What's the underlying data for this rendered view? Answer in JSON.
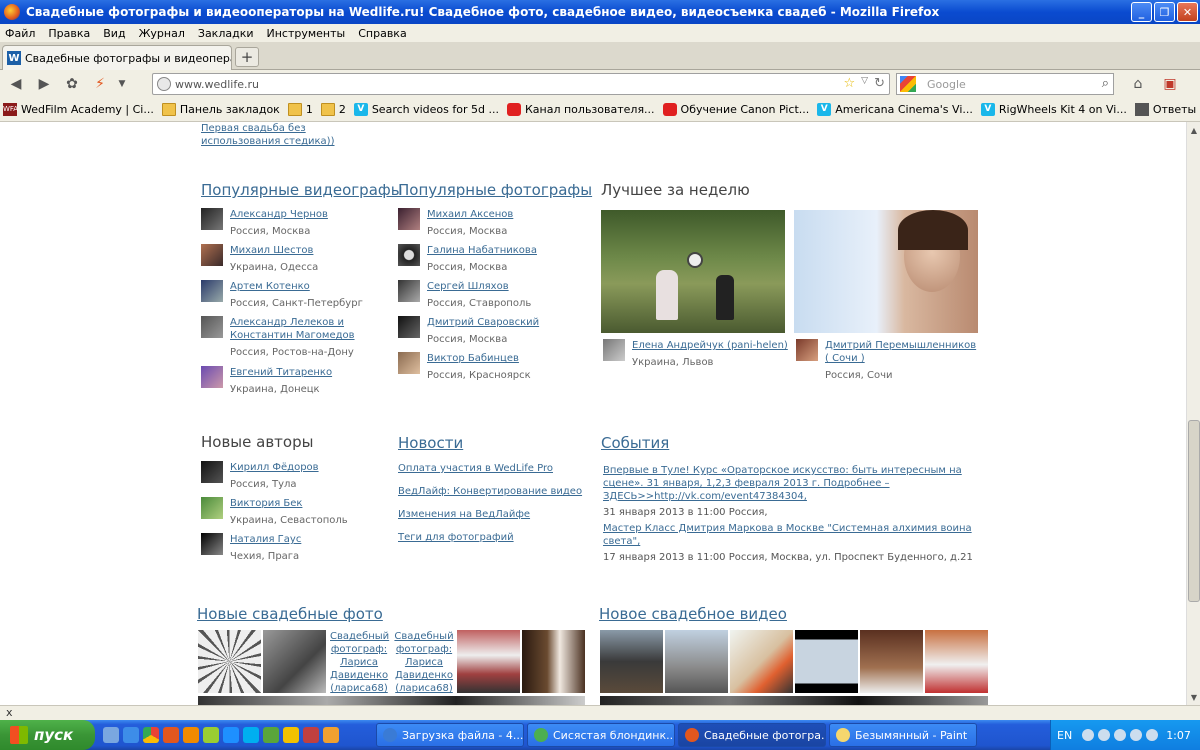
{
  "window": {
    "title": "Свадебные фотографы и видеооператоры на Wedlife.ru! Свадебное фото, свадебное видео, видеосъемка свадеб - Mozilla Firefox"
  },
  "menu": [
    "Файл",
    "Правка",
    "Вид",
    "Журнал",
    "Закладки",
    "Инструменты",
    "Справка"
  ],
  "tab": {
    "label": "Свадебные фотографы и видеоператор..."
  },
  "address": {
    "url": "www.wedlife.ru"
  },
  "search": {
    "placeholder": "Google"
  },
  "bookmarks": [
    {
      "label": "WedFilm Academy | Ci...",
      "icon": "wfa"
    },
    {
      "label": "Панель закладок",
      "icon": "folder"
    },
    {
      "label": "1",
      "icon": "folder"
    },
    {
      "label": "2",
      "icon": "folder"
    },
    {
      "label": "Search videos for 5d ...",
      "icon": "vm"
    },
    {
      "label": "Канал пользователя...",
      "icon": "yt"
    },
    {
      "label": "Обучение Canon Pict...",
      "icon": "yt"
    },
    {
      "label": "Americana Cinema's Vi...",
      "icon": "vm"
    },
    {
      "label": "RigWheels Kit 4 on Vi...",
      "icon": "vm"
    },
    {
      "label": "Ответы на 105 вопр...",
      "icon": "clap"
    }
  ],
  "page": {
    "top_link": "Первая свадьба без использования стедика))",
    "videographers": {
      "title": "Популярные видеографы",
      "items": [
        {
          "name": "Александр Чернов",
          "location": "Россия, Москва"
        },
        {
          "name": "Михаил Шестов",
          "location": "Украина, Одесса"
        },
        {
          "name": "Артем Котенко",
          "location": "Россия, Санкт-Петербург"
        },
        {
          "name": "Александр Лелеков и Константин Магомедов",
          "location": "Россия, Ростов-на-Дону"
        },
        {
          "name": "Евгений Титаренко",
          "location": "Украина, Донецк"
        }
      ]
    },
    "photographers": {
      "title": "Популярные фотографы",
      "items": [
        {
          "name": "Михаил Аксенов",
          "location": "Россия, Москва"
        },
        {
          "name": "Галина Набатникова",
          "location": "Россия, Москва"
        },
        {
          "name": "Сергей Шляхов",
          "location": "Россия, Ставрополь"
        },
        {
          "name": "Дмитрий Сваровский",
          "location": "Россия, Москва"
        },
        {
          "name": "Виктор Бабинцев",
          "location": "Россия, Красноярск"
        }
      ]
    },
    "best_week": {
      "title": "Лучшее за неделю",
      "items": [
        {
          "name": "Елена Андрейчук (pani-helen)",
          "location": "Украина, Львов"
        },
        {
          "name": "Дмитрий Перемышленников ( Сочи )",
          "location": "Россия, Сочи"
        }
      ]
    },
    "new_authors": {
      "title": "Новые авторы",
      "items": [
        {
          "name": "Кирилл Фёдоров",
          "location": "Россия, Тула"
        },
        {
          "name": "Виктория Бек",
          "location": "Украина, Севастополь"
        },
        {
          "name": "Наталия Гаус",
          "location": "Чехия, Прага"
        }
      ]
    },
    "news": {
      "title": "Новости",
      "items": [
        "Оплата участия в WedLife Pro",
        "ВедЛайф: Конвертирование видео",
        "Изменения на ВедЛайфе",
        "Теги для фотографий"
      ]
    },
    "events": {
      "title": "События",
      "items": [
        {
          "title": "Впервые в Туле! Курс «Ораторское искусство: быть интересным на сцене». 31 января, 1,2,3 февраля 2013 г. Подробнее – ЗДЕСЬ>>http://vk.com/event47384304,",
          "details": "31 января 2013 в 11:00  Россия,"
        },
        {
          "title": "Мастер Класс Дмитрия Маркова в Москве \"Системная алхимия воина света\",",
          "details": "17 января 2013 в 11:00  Россия, Москва, ул. Проспект Буденного, д.21"
        }
      ]
    },
    "new_photos": {
      "title": "Новые свадебные фото",
      "captions": [
        "Свадебный фотограф: Лариса Давиденко (лариса68)",
        "Свадебный фотограф: Лариса Давиденко (лариса68)"
      ]
    },
    "new_video": {
      "title": "Новое свадебное видео"
    }
  },
  "statusbar": {
    "text": "x"
  },
  "taskbar": {
    "start": "пуск",
    "windows": [
      {
        "label": "Загрузка файла - 4...",
        "color": "#3a7bd5"
      },
      {
        "label": "Сисястая блондинк...",
        "color": "#4caf50"
      },
      {
        "label": "Свадебные фотогра...",
        "color": "#e2571e"
      },
      {
        "label": "Безымянный - Paint",
        "color": "#f5d76e"
      }
    ],
    "lang": "EN",
    "clock": "1:07"
  }
}
